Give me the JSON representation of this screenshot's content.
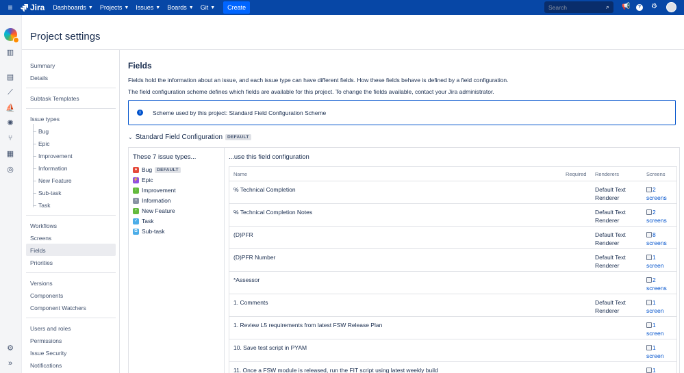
{
  "topnav": {
    "product": "Jira",
    "menus": [
      "Dashboards",
      "Projects",
      "Issues",
      "Boards",
      "Git"
    ],
    "create_label": "Create",
    "search_placeholder": "Search"
  },
  "header": {
    "title": "Project settings"
  },
  "sidebar": {
    "summary": "Summary",
    "details": "Details",
    "subtask_templates": "Subtask Templates",
    "issue_types": "Issue types",
    "issue_type_items": [
      "Bug",
      "Epic",
      "Improvement",
      "Information",
      "New Feature",
      "Sub-task",
      "Task"
    ],
    "workflows": "Workflows",
    "screens": "Screens",
    "fields": "Fields",
    "priorities": "Priorities",
    "versions": "Versions",
    "components": "Components",
    "component_watchers": "Component Watchers",
    "users_and_roles": "Users and roles",
    "permissions": "Permissions",
    "issue_security": "Issue Security",
    "notifications": "Notifications"
  },
  "main": {
    "title": "Fields",
    "para1": "Fields hold the information about an issue, and each issue type can have different fields. How these fields behave is defined by a field configuration.",
    "para2": "The field configuration scheme defines which fields are available for this project. To change the fields available, contact your Jira administrator.",
    "info_text": "Scheme used by this project: Standard Field Configuration Scheme",
    "config_title": "Standard Field Configuration",
    "default_badge": "DEFAULT",
    "issue_types_heading": "These 7 issue types...",
    "issue_types": [
      {
        "name": "Bug",
        "color": "#e5493a",
        "badge": "DEFAULT"
      },
      {
        "name": "Epic",
        "color": "#904ee2",
        "badge": ""
      },
      {
        "name": "Improvement",
        "color": "#63ba3c",
        "badge": ""
      },
      {
        "name": "Information",
        "color": "#8993a4",
        "badge": ""
      },
      {
        "name": "New Feature",
        "color": "#63ba3c",
        "badge": ""
      },
      {
        "name": "Task",
        "color": "#4bade8",
        "badge": ""
      },
      {
        "name": "Sub-task",
        "color": "#4bade8",
        "badge": ""
      }
    ],
    "fields_heading": "...use this field configuration",
    "columns": {
      "name": "Name",
      "required": "Required",
      "renderers": "Renderers",
      "screens": "Screens"
    },
    "fields": [
      {
        "name": "% Technical Completion",
        "renderer": "Default Text Renderer",
        "screens": "2 screens"
      },
      {
        "name": "% Technical Completion Notes",
        "renderer": "Default Text Renderer",
        "screens": "2 screens"
      },
      {
        "name": "(D)PFR",
        "renderer": "Default Text Renderer",
        "screens": "8 screens"
      },
      {
        "name": "(D)PFR Number",
        "renderer": "Default Text Renderer",
        "screens": "1 screen"
      },
      {
        "name": "*Assessor",
        "renderer": "",
        "screens": "2 screens"
      },
      {
        "name": "1. Comments",
        "renderer": "Default Text Renderer",
        "screens": "1 screen"
      },
      {
        "name": "1. Review L5 requirements from latest FSW Release Plan",
        "renderer": "",
        "screens": "1 screen"
      },
      {
        "name": "10. Save test script in PYAM",
        "renderer": "",
        "screens": "1 screen"
      },
      {
        "name": "11. Once a FSW module is released, run the FIT script using latest weekly build",
        "renderer": "",
        "screens": "1"
      }
    ]
  }
}
